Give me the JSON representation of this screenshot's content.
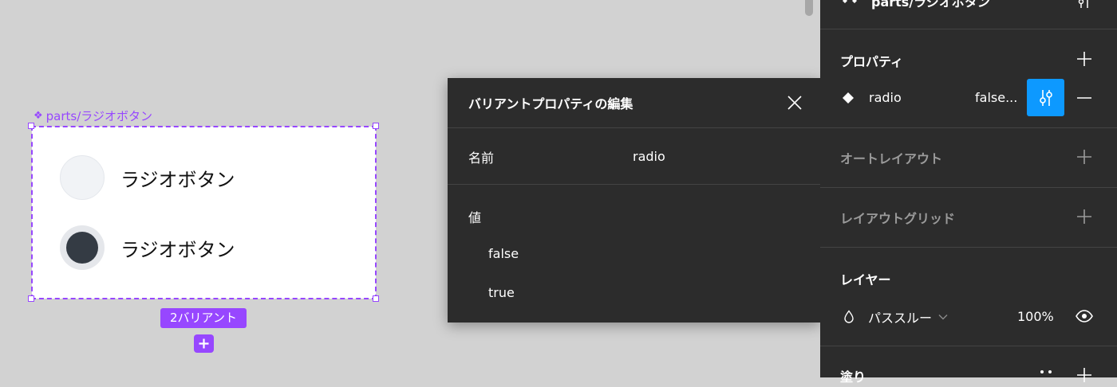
{
  "canvas": {
    "component_label": "parts/ラジオボタン",
    "radio_options": [
      {
        "label": "ラジオボタン",
        "checked": false
      },
      {
        "label": "ラジオボタン",
        "checked": true
      }
    ],
    "variant_count_label": "2バリアント",
    "accent_color": "#9747ff"
  },
  "dialog": {
    "title": "バリアントプロパティの編集",
    "name_label": "名前",
    "name_value": "radio",
    "values_label": "値",
    "values": [
      "false",
      "true"
    ]
  },
  "panel": {
    "top_title": "parts/ラジオボタン",
    "properties": {
      "title": "プロパティ",
      "items": [
        {
          "name": "radio",
          "value": "false..."
        }
      ]
    },
    "auto_layout": {
      "title": "オートレイアウト"
    },
    "layout_grid": {
      "title": "レイアウトグリッド"
    },
    "layer": {
      "title": "レイヤー",
      "blend_mode": "パススルー",
      "opacity": "100%"
    },
    "fill": {
      "title": "塗り"
    },
    "accent_color": "#0d99ff"
  }
}
